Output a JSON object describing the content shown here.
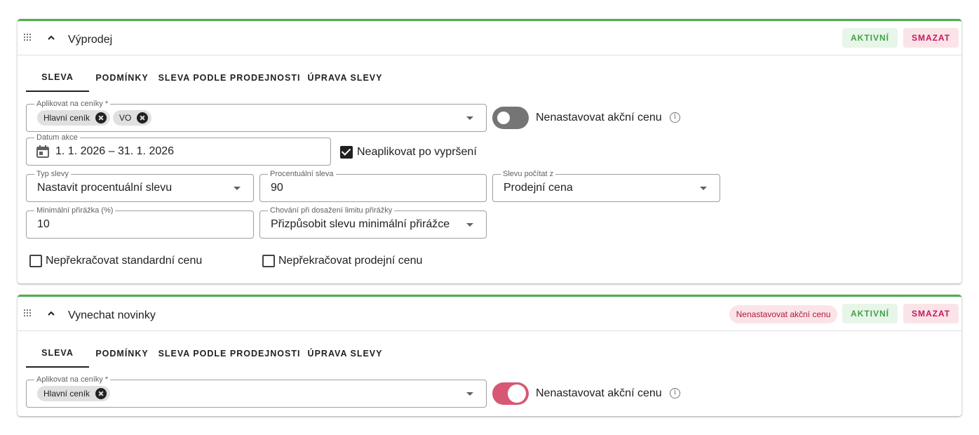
{
  "tabs": [
    "SLEVA",
    "PODMÍNKY",
    "SLEVA PODLE PRODEJNOSTI",
    "ÚPRAVA SLEVY"
  ],
  "buttons": {
    "active": "AKTIVNÍ",
    "delete": "SMAZAT"
  },
  "icons": {
    "drag": "drag-handle-icon",
    "collapse": "chevron-up-icon",
    "remove": "remove-chip-icon",
    "dropdown": "dropdown-arrow-icon",
    "calendar": "calendar-icon",
    "info": "info-icon"
  },
  "colors": {
    "accent": "#4caf50",
    "active_bg": "#e8f5e9",
    "active_text": "#43a047",
    "delete_bg": "#fbe4e8",
    "delete_text": "#c2185b",
    "toggle_on": "#d65874"
  },
  "card1": {
    "title": "Výprodej",
    "pricelists": {
      "label": "Aplikovat na ceníky *",
      "chips": [
        "Hlavní ceník",
        "VO"
      ]
    },
    "no_promo_price": {
      "label": "Nenastavovat akční cenu",
      "on": false
    },
    "date": {
      "label": "Datum akce",
      "value": "1. 1. 2026 – 31. 1. 2026"
    },
    "no_apply_after_expiry": {
      "label": "Neaplikovat po vypršení",
      "checked": true
    },
    "discount_type": {
      "label": "Typ slevy",
      "value": "Nastavit procentuální slevu"
    },
    "percent": {
      "label": "Procentuální sleva",
      "value": "90"
    },
    "calc_from": {
      "label": "Slevu počítat z",
      "value": "Prodejní cena"
    },
    "min_markup": {
      "label": "Minimální přirážka (%)",
      "value": "10"
    },
    "limit_behavior": {
      "label": "Chování při dosažení limitu přirážky",
      "value": "Přizpůsobit slevu minimální přirážce"
    },
    "no_exceed_standard": {
      "label": "Nepřekračovat standardní cenu",
      "checked": false
    },
    "no_exceed_sale": {
      "label": "Nepřekračovat prodejní cenu",
      "checked": false
    }
  },
  "card2": {
    "title": "Vynechat novinky",
    "badge": "Nenastavovat akční cenu",
    "pricelists": {
      "label": "Aplikovat na ceníky *",
      "chips": [
        "Hlavní ceník"
      ]
    },
    "no_promo_price": {
      "label": "Nenastavovat akční cenu",
      "on": true
    }
  }
}
